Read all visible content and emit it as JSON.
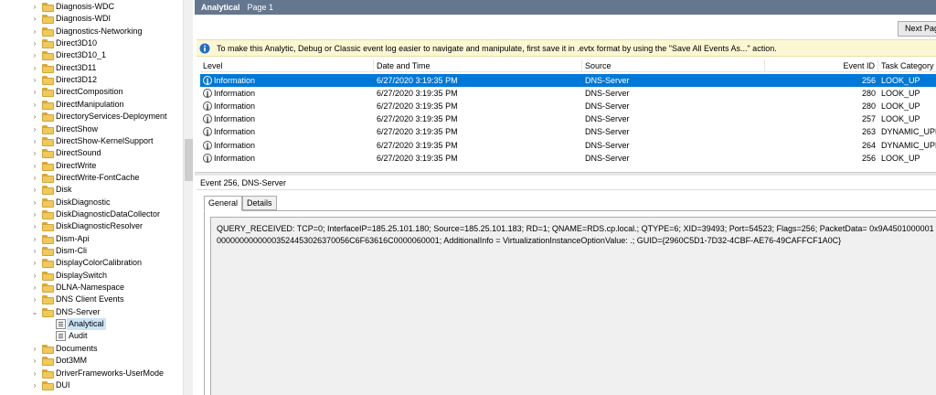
{
  "tree": {
    "items": [
      {
        "label": "Diagnosis-WDC",
        "type": "folder",
        "depth": 0,
        "expander": "›"
      },
      {
        "label": "Diagnosis-WDI",
        "type": "folder",
        "depth": 0,
        "expander": "›"
      },
      {
        "label": "Diagnostics-Networking",
        "type": "folder",
        "depth": 0,
        "expander": "›"
      },
      {
        "label": "Direct3D10",
        "type": "folder",
        "depth": 0,
        "expander": "›"
      },
      {
        "label": "Direct3D10_1",
        "type": "folder",
        "depth": 0,
        "expander": "›"
      },
      {
        "label": "Direct3D11",
        "type": "folder",
        "depth": 0,
        "expander": "›"
      },
      {
        "label": "Direct3D12",
        "type": "folder",
        "depth": 0,
        "expander": "›"
      },
      {
        "label": "DirectComposition",
        "type": "folder",
        "depth": 0,
        "expander": "›"
      },
      {
        "label": "DirectManipulation",
        "type": "folder",
        "depth": 0,
        "expander": "›"
      },
      {
        "label": "DirectoryServices-Deployment",
        "type": "folder",
        "depth": 0,
        "expander": "›"
      },
      {
        "label": "DirectShow",
        "type": "folder",
        "depth": 0,
        "expander": "›"
      },
      {
        "label": "DirectShow-KernelSupport",
        "type": "folder",
        "depth": 0,
        "expander": "›"
      },
      {
        "label": "DirectSound",
        "type": "folder",
        "depth": 0,
        "expander": "›"
      },
      {
        "label": "DirectWrite",
        "type": "folder",
        "depth": 0,
        "expander": "›"
      },
      {
        "label": "DirectWrite-FontCache",
        "type": "folder",
        "depth": 0,
        "expander": "›"
      },
      {
        "label": "Disk",
        "type": "folder",
        "depth": 0,
        "expander": "›"
      },
      {
        "label": "DiskDiagnostic",
        "type": "folder",
        "depth": 0,
        "expander": "›"
      },
      {
        "label": "DiskDiagnosticDataCollector",
        "type": "folder",
        "depth": 0,
        "expander": "›"
      },
      {
        "label": "DiskDiagnosticResolver",
        "type": "folder",
        "depth": 0,
        "expander": "›"
      },
      {
        "label": "Dism-Api",
        "type": "folder",
        "depth": 0,
        "expander": "›"
      },
      {
        "label": "Dism-Cli",
        "type": "folder",
        "depth": 0,
        "expander": "›"
      },
      {
        "label": "DisplayColorCalibration",
        "type": "folder",
        "depth": 0,
        "expander": "›"
      },
      {
        "label": "DisplaySwitch",
        "type": "folder",
        "depth": 0,
        "expander": "›"
      },
      {
        "label": "DLNA-Namespace",
        "type": "folder",
        "depth": 0,
        "expander": "›"
      },
      {
        "label": "DNS Client Events",
        "type": "folder",
        "depth": 0,
        "expander": "›"
      },
      {
        "label": "DNS-Server",
        "type": "folder",
        "depth": 0,
        "expander": "⌄"
      },
      {
        "label": "Analytical",
        "type": "log",
        "depth": 1,
        "expander": "",
        "selected": true
      },
      {
        "label": "Audit",
        "type": "log",
        "depth": 1,
        "expander": ""
      },
      {
        "label": "Documents",
        "type": "folder",
        "depth": 0,
        "expander": "›"
      },
      {
        "label": "Dot3MM",
        "type": "folder",
        "depth": 0,
        "expander": "›"
      },
      {
        "label": "DriverFrameworks-UserMode",
        "type": "folder",
        "depth": 0,
        "expander": "›"
      },
      {
        "label": "DUI",
        "type": "folder",
        "depth": 0,
        "expander": "›"
      }
    ]
  },
  "header": {
    "title": "Analytical",
    "page": "Page 1"
  },
  "toolbar": {
    "next_page_label": "Next Page"
  },
  "info_bar": {
    "text": "To make this Analytic, Debug or Classic event log easier to navigate and manipulate, first save it in .evtx format by using the \"Save All Events As...\" action."
  },
  "table": {
    "columns": [
      "Level",
      "Date and Time",
      "Source",
      "Event ID",
      "Task Category"
    ],
    "rows": [
      {
        "level": "Information",
        "datetime": "6/27/2020 3:19:35 PM",
        "source": "DNS-Server",
        "event_id": "256",
        "category": "LOOK_UP",
        "selected": true
      },
      {
        "level": "Information",
        "datetime": "6/27/2020 3:19:35 PM",
        "source": "DNS-Server",
        "event_id": "280",
        "category": "LOOK_UP"
      },
      {
        "level": "Information",
        "datetime": "6/27/2020 3:19:35 PM",
        "source": "DNS-Server",
        "event_id": "280",
        "category": "LOOK_UP"
      },
      {
        "level": "Information",
        "datetime": "6/27/2020 3:19:35 PM",
        "source": "DNS-Server",
        "event_id": "257",
        "category": "LOOK_UP"
      },
      {
        "level": "Information",
        "datetime": "6/27/2020 3:19:35 PM",
        "source": "DNS-Server",
        "event_id": "263",
        "category": "DYNAMIC_UPD"
      },
      {
        "level": "Information",
        "datetime": "6/27/2020 3:19:35 PM",
        "source": "DNS-Server",
        "event_id": "264",
        "category": "DYNAMIC_UPD"
      },
      {
        "level": "Information",
        "datetime": "6/27/2020 3:19:35 PM",
        "source": "DNS-Server",
        "event_id": "256",
        "category": "LOOK_UP"
      }
    ]
  },
  "detail": {
    "title": "Event 256, DNS-Server",
    "tabs": [
      "General",
      "Details"
    ],
    "active_tab": "General",
    "text": "QUERY_RECEIVED: TCP=0; InterfaceIP=185.25.101.180; Source=185.25.101.183; RD=1; QNAME=RDS.cp.local.; QTYPE=6; XID=39493; Port=54523; Flags=256; PacketData= 0x9A450100000100000000000003524453026370056C6F63616C0000060001; AdditionalInfo = VirtualizationInstanceOptionValue: .; GUID={2960C5D1-7D32-4CBF-AE76-49CAFFCF1A0C}"
  },
  "colors": {
    "header_bg": "#64778f",
    "selection": "#0078d7",
    "info_bar_bg": "#fcf7d3",
    "folder": "#f0c95a"
  }
}
